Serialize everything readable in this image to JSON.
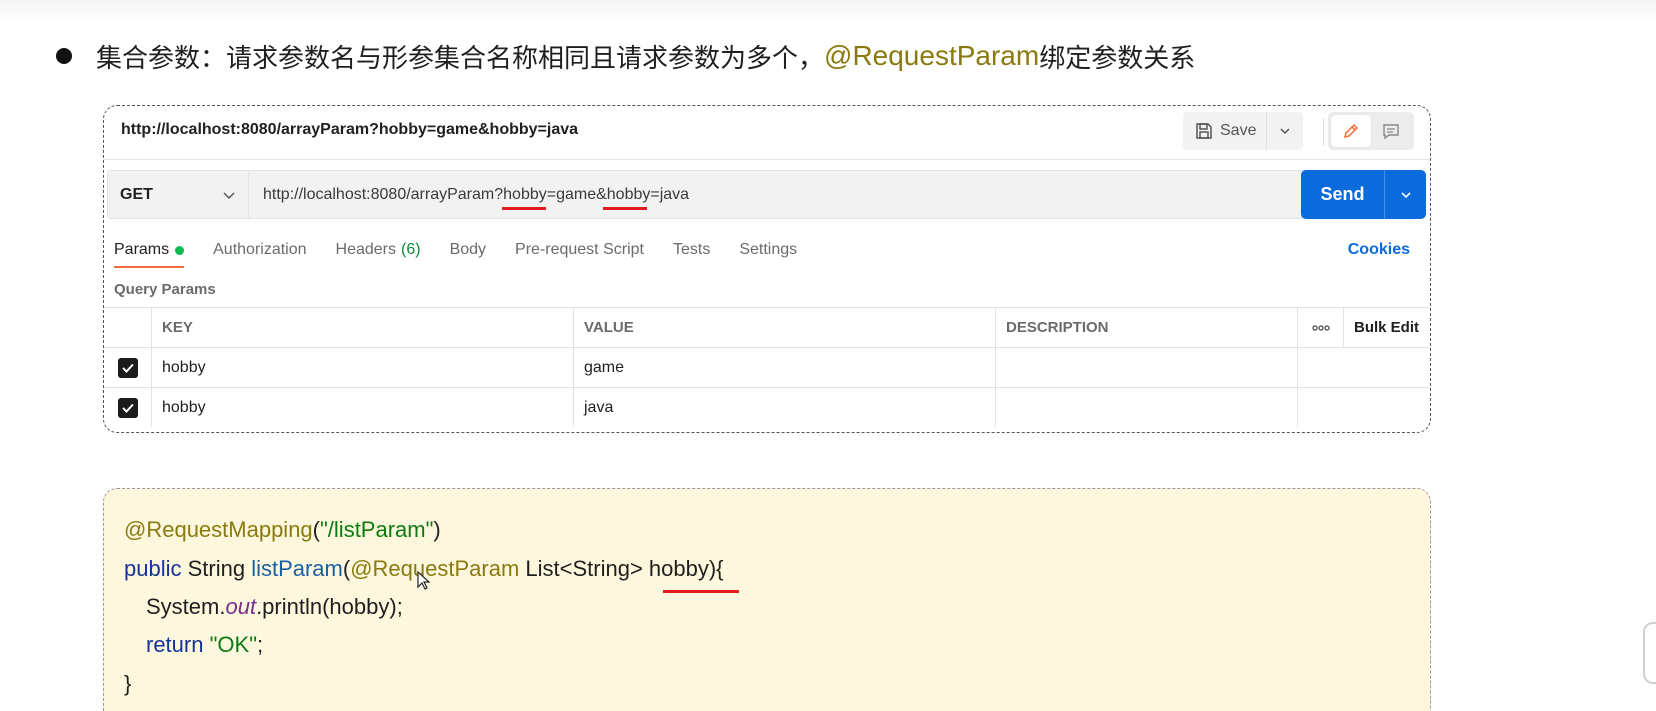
{
  "slide": {
    "bullet_text": "集合参数：请求参数名与形参集合名称相同且请求参数为多个，",
    "bullet_highlight": "@RequestParam",
    "bullet_tail": " 绑定参数关系"
  },
  "postman": {
    "request_title": "http://localhost:8080/arrayParam?hobby=game&hobby=java",
    "save_label": "Save",
    "method": "GET",
    "url_parts": [
      "http://localhost:8080/arrayParam?",
      "hobby",
      "=game&",
      "hobby",
      "=java"
    ],
    "send_label": "Send",
    "tabs": [
      {
        "label": "Params"
      },
      {
        "label": "Authorization"
      },
      {
        "label": "Headers",
        "count": "(6)"
      },
      {
        "label": "Body"
      },
      {
        "label": "Pre-request Script"
      },
      {
        "label": "Tests"
      },
      {
        "label": "Settings"
      }
    ],
    "cookies_label": "Cookies",
    "query_params_label": "Query Params",
    "columns": {
      "key": "KEY",
      "value": "VALUE",
      "description": "DESCRIPTION",
      "bulk_edit": "Bulk Edit"
    },
    "rows": [
      {
        "key": "hobby",
        "value": "game",
        "description": ""
      },
      {
        "key": "hobby",
        "value": "java",
        "description": ""
      }
    ]
  },
  "code": {
    "line1": {
      "annotation": "@RequestMapping",
      "rest": "(",
      "string": "\"/listParam\"",
      "close": ")"
    },
    "line2": {
      "kw": "public",
      "type": " String ",
      "fn": "listParam",
      "open": "(",
      "annotation": "@RequestParam",
      "params": " List<String> hobby){"
    },
    "line3": {
      "prefix": "System.",
      "field": "out",
      "rest": ".println(hobby);"
    },
    "line4": {
      "kw": "return",
      "space": " ",
      "string": "\"OK\"",
      "rest": ";"
    },
    "line5": {
      "text": "}"
    }
  },
  "colors": {
    "accent_send": "#0b6bdc",
    "annotation": "#8b7a10",
    "active_tab_underline": "#f26b3a",
    "params_dot": "#0cbb52",
    "red_underline": "#e01e1e"
  },
  "icons": [
    "save-icon",
    "chevron-down-icon",
    "pencil-icon",
    "comment-icon",
    "checkbox-checked-icon",
    "more-horiz-icon",
    "cursor-pointer-icon"
  ]
}
